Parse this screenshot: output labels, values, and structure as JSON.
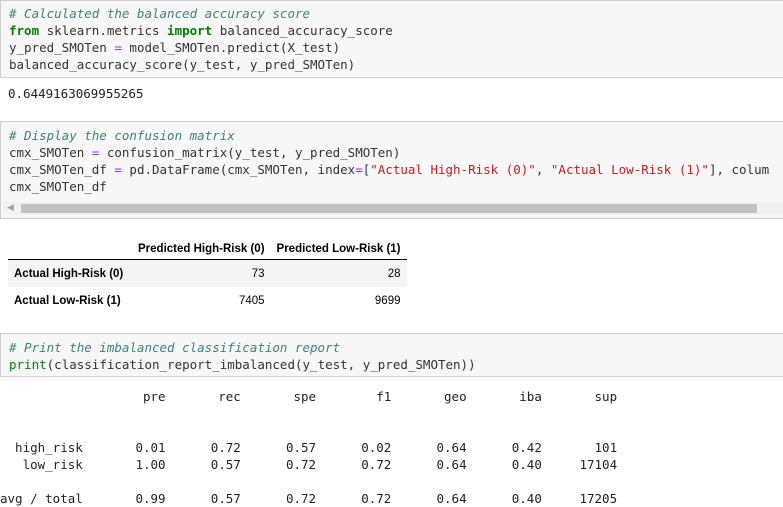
{
  "cell1": {
    "comment": "# Calculated the balanced accuracy score",
    "l2_from": "from",
    "l2_mod": " sklearn.metrics ",
    "l2_import": "import",
    "l2_rest": " balanced_accuracy_score",
    "l3_a": "y_pred_SMOTen ",
    "l3_eq": "=",
    "l3_b": " model_SMOTen.predict(X_test)",
    "l4": "balanced_accuracy_score(y_test, y_pred_SMOTen)",
    "output": "0.6449163069955265"
  },
  "cell2": {
    "comment": "# Display the confusion matrix",
    "l2_a": "cmx_SMOTen ",
    "l2_eq": "=",
    "l2_b": " confusion_matrix(y_test, y_pred_SMOTen)",
    "l3_a": "cmx_SMOTen_df ",
    "l3_eq": "=",
    "l3_b": " pd.DataFrame(cmx_SMOTen, index",
    "l3_eq2": "=",
    "l3_c": "[",
    "l3_s1": "\"Actual High-Risk (0)\"",
    "l3_d": ", ",
    "l3_s2": "\"Actual Low-Risk (1)\"",
    "l3_e": "], colum",
    "l4": "cmx_SMOTen_df"
  },
  "dataframe": {
    "columns": [
      "",
      "Predicted High-Risk (0)",
      "Predicted Low-Risk (1)"
    ],
    "rows": [
      {
        "label": "Actual High-Risk (0)",
        "values": [
          "73",
          "28"
        ]
      },
      {
        "label": "Actual Low-Risk (1)",
        "values": [
          "7405",
          "9699"
        ]
      }
    ]
  },
  "cell3": {
    "comment": "# Print the imbalanced classification report",
    "l2_print": "print",
    "l2_rest": "(classification_report_imbalanced(y_test, y_pred_SMOTen))"
  },
  "report": {
    "header": "                   pre       rec       spe        f1       geo       iba       sup",
    "row1": "  high_risk       0.01      0.72      0.57      0.02      0.64      0.42       101",
    "row2": "   low_risk       1.00      0.57      0.72      0.72      0.64      0.40     17104",
    "avg": "avg / total       0.99      0.57      0.72      0.72      0.64      0.40     17205"
  }
}
